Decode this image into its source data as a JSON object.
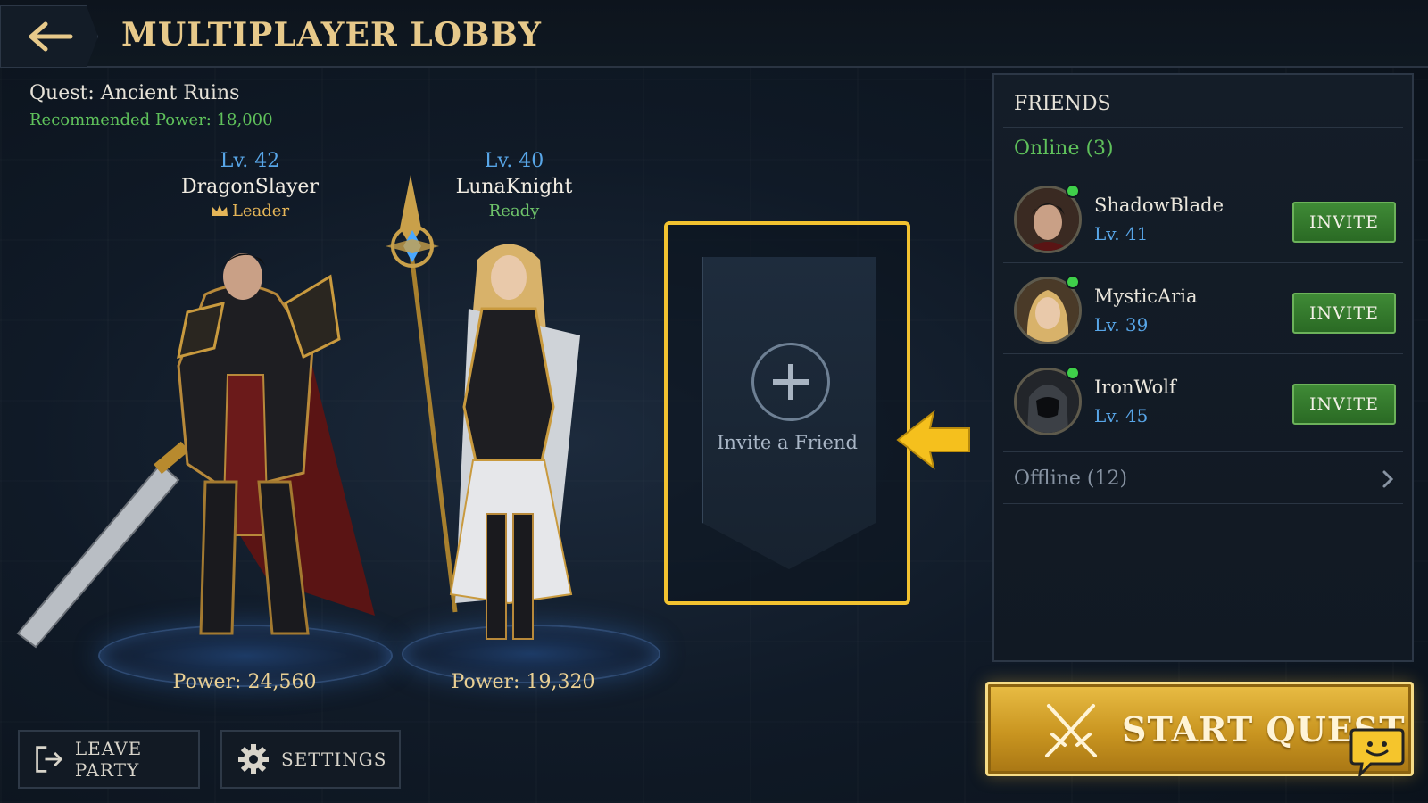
{
  "header": {
    "title": "MULTIPLAYER LOBBY",
    "back_icon": "arrow-left-icon"
  },
  "quest": {
    "name": "Quest: Ancient Ruins",
    "recommended_power": "Recommended Power: 18,000"
  },
  "party": [
    {
      "level": "Lv. 42",
      "name": "DragonSlayer",
      "role": "Leader",
      "power": "Power: 24,560"
    },
    {
      "level": "Lv. 40",
      "name": "LunaKnight",
      "role": "Ready",
      "power": "Power: 19,320"
    }
  ],
  "invite_slot": {
    "label": "Invite a Friend"
  },
  "friends": {
    "title": "FRIENDS",
    "online_label": "Online (3)",
    "online": [
      {
        "name": "ShadowBlade",
        "level": "Lv. 41",
        "button": "INVITE"
      },
      {
        "name": "MysticAria",
        "level": "Lv. 39",
        "button": "INVITE"
      },
      {
        "name": "IronWolf",
        "level": "Lv. 45",
        "button": "INVITE"
      }
    ],
    "offline_label": "Offline (12)"
  },
  "actions": {
    "start_quest": "START QUEST",
    "leave_party": "LEAVE PARTY",
    "settings": "SETTINGS"
  },
  "colors": {
    "accent_gold": "#e7c98a",
    "online_green": "#5fc15b",
    "level_blue": "#58a6e8",
    "highlight_yellow": "#f2c230"
  }
}
